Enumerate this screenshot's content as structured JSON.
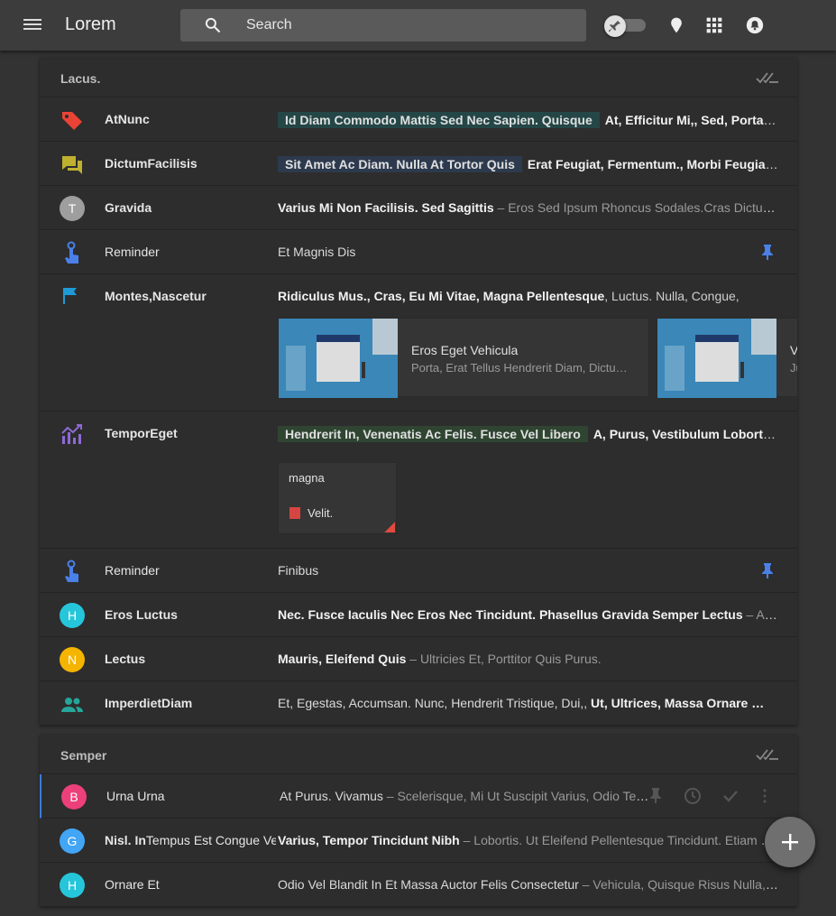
{
  "app": {
    "title": "Lorem"
  },
  "search": {
    "placeholder": "Search"
  },
  "colors": {
    "accent_blue": "#3b7cd6",
    "topbar": "#3c3c3c",
    "background": "#333333",
    "card": "#2d2d2d"
  },
  "icons": [
    "menu-icon",
    "search-icon",
    "pin-toggle-icon",
    "lightbulb-icon",
    "apps-grid-icon",
    "notifications-icon"
  ],
  "sections": [
    {
      "title": "Lacus.",
      "rows": [
        {
          "sender": "AtNunc",
          "icon": "label-tag-icon",
          "chip": "Id Diam Commodo Mattis Sed Nec Sapien. Quisque",
          "bold": "At, Efficitur Mi,, Sed, Porta Ne…"
        },
        {
          "sender": "DictumFacilisis",
          "icon": "forum-icon",
          "chip": "Sit Amet Ac Diam. Nulla At Tortor Quis",
          "bold": "Erat Feugiat, Fermentum., Morbi Feugiat, T…"
        },
        {
          "sender": "Gravida",
          "avatar": "T",
          "bold": "Varius Mi Non Facilisis. Sed Sagittis",
          "snippet": " – Eros Sed Ipsum Rhoncus Sodales.Cras Dictum Eni…"
        },
        {
          "sender": "Reminder",
          "icon": "reminder-hand-icon",
          "text": "Et Magnis Dis"
        },
        {
          "sender": "Montes,Nascetur",
          "icon": "flag-icon",
          "bold": "Ridiculus Mus., Cras, Eu Mi Vitae, Magna Pellentesque",
          "snippet": ", Luctus. Nulla, Congue,",
          "cards": [
            {
              "title": "Eros Eget Vehicula",
              "sub": "Porta, Erat Tellus Hendrerit Diam, Dictu…"
            },
            {
              "title": "V",
              "sub": "Ju"
            }
          ]
        },
        {
          "sender": "TemporEget",
          "icon": "trending-chart-icon",
          "chip": "Hendrerit In, Venenatis Ac Felis. Fusce Vel Libero",
          "bold": "A, Purus, Vestibulum Lobortis., V…",
          "attachment": {
            "title": "magna",
            "file": "Velit."
          }
        },
        {
          "sender": "Reminder",
          "icon": "reminder-hand-icon",
          "text": "Finibus"
        },
        {
          "sender": "Eros Luctus",
          "avatar": "H",
          "bold": "Nec. Fusce Iaculis Nec Eros Nec Tincidunt. Phasellus Gravida Semper Lectus",
          "snippet": " – Ac Ele…"
        },
        {
          "sender": "Lectus",
          "avatar": "N",
          "bold": "Mauris, Eleifend Quis",
          "snippet": " – Ultricies Et, Porttitor Quis Purus."
        },
        {
          "sender": "ImperdietDiam",
          "icon": "group-icon",
          "text": "Et, Egestas, Accumsan. Nunc, Hendrerit Tristique, Dui,, ",
          "bold": "Ut, Ultrices, Massa Ornare …"
        }
      ]
    },
    {
      "title": "Semper",
      "rows": [
        {
          "sender": "Urna Urna",
          "avatar": "B",
          "text": "At Purus. Vivamus",
          "snippet": " – Scelerisque, Mi Ut Suscipit Varius, Odio Tellu…"
        },
        {
          "sender": "Nisl. In",
          "sender2": "Tempus Est Congue Velit",
          "avatar": "G",
          "bold": "Varius, Tempor Tincidunt Nibh",
          "snippet": " – Lobortis. Ut Eleifend Pellentesque Tincidunt. Etiam Nec S…"
        },
        {
          "sender": "Ornare Et",
          "avatar": "H",
          "text": "Odio Vel Blandit In Et Massa Auctor Felis Consectetur",
          "snippet": " – Vehicula, Quisque Risus Nulla, Phar…"
        }
      ]
    }
  ]
}
